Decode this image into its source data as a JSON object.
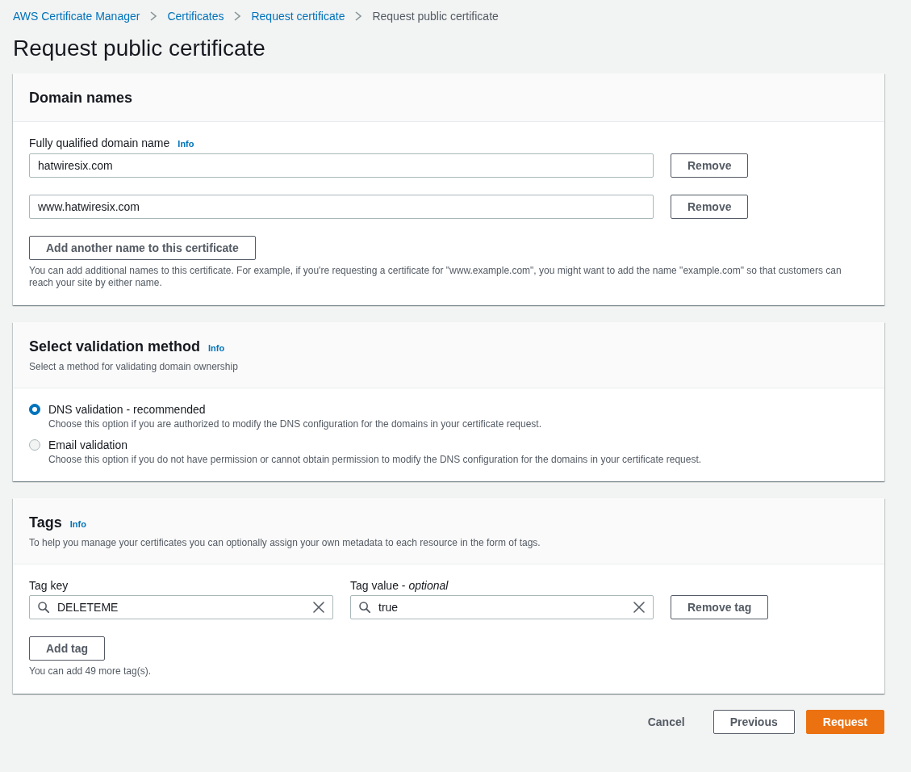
{
  "breadcrumbs": [
    {
      "label": "AWS Certificate Manager",
      "current": false
    },
    {
      "label": "Certificates",
      "current": false
    },
    {
      "label": "Request certificate",
      "current": false
    },
    {
      "label": "Request public certificate",
      "current": true
    }
  ],
  "page_title": "Request public certificate",
  "domain_names": {
    "title": "Domain names",
    "field_label": "Fully qualified domain name",
    "info": "Info",
    "names": [
      {
        "value": "hatwiresix.com",
        "remove_button": "Remove"
      },
      {
        "value": "www.hatwiresix.com",
        "remove_button": "Remove"
      }
    ],
    "add_button": "Add another name to this certificate",
    "help": "You can add additional names to this certificate. For example, if you're requesting a certificate for \"www.example.com\", you might want to add the name \"example.com\" so that customers can reach your site by either name."
  },
  "validation_method": {
    "title": "Select validation method",
    "info": "Info",
    "description": "Select a method for validating domain ownership",
    "options": [
      {
        "label": "DNS validation - recommended",
        "description": "Choose this option if you are authorized to modify the DNS configuration for the domains in your certificate request.",
        "selected": true
      },
      {
        "label": "Email validation",
        "description": "Choose this option if you do not have permission or cannot obtain permission to modify the DNS configuration for the domains in your certificate request.",
        "selected": false
      }
    ]
  },
  "tags": {
    "title": "Tags",
    "info": "Info",
    "description": "To help you manage your certificates you can optionally assign your own metadata to each resource in the form of tags.",
    "key_label": "Tag key",
    "value_label": "Tag value - *optional*",
    "rows": [
      {
        "key": "DELETEME",
        "value": "true",
        "remove_button": "Remove tag"
      }
    ],
    "add_button": "Add tag",
    "help": "You can add 49 more tag(s)."
  },
  "actions": [
    {
      "label": "Cancel",
      "kind": "link"
    },
    {
      "label": "Previous",
      "kind": "normal"
    },
    {
      "label": "Request",
      "kind": "primary"
    }
  ]
}
